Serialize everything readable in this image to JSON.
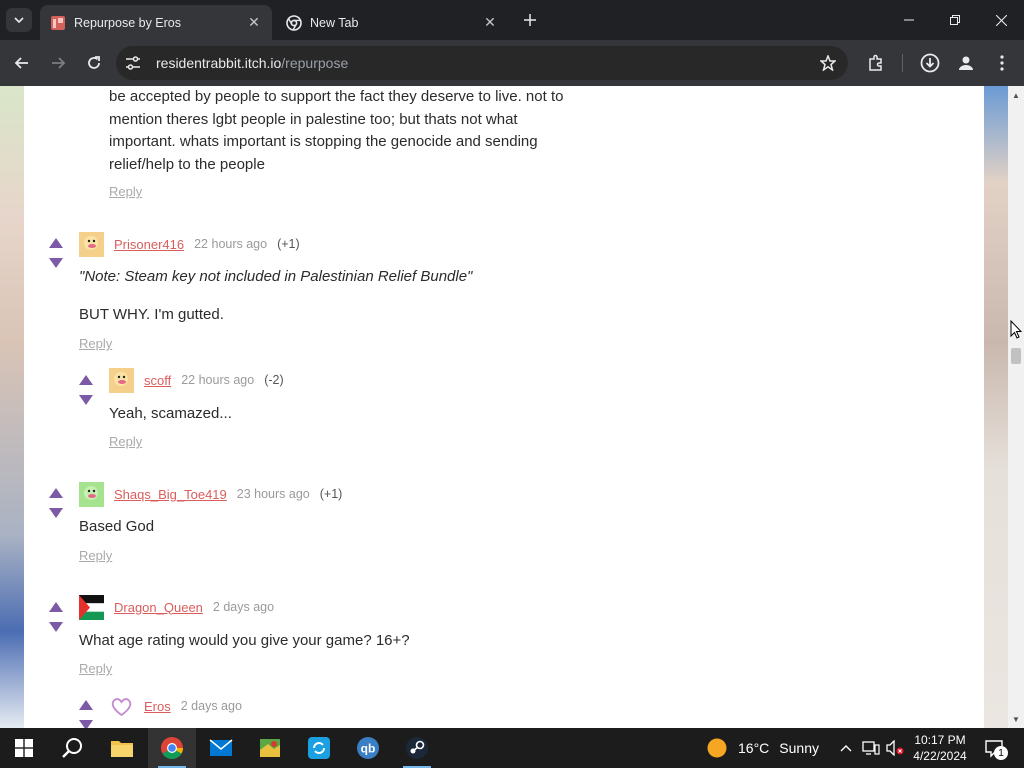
{
  "browser": {
    "tabs": [
      {
        "title": "Repurpose by Eros",
        "active": true
      },
      {
        "title": "New Tab",
        "active": false
      }
    ],
    "url_host": "residentrabbit.itch.io",
    "url_path": "/repurpose"
  },
  "page": {
    "reply_label": "Reply",
    "top_comment_tail": [
      "be accepted by people to support the fact they deserve to live. not to",
      "mention theres lgbt people in palestine too; but thats not what",
      "important. whats important is stopping the genocide and sending",
      "relief/help to the people"
    ],
    "comments": [
      {
        "username": "Prisoner416",
        "time": "22 hours ago",
        "score": "(+1)",
        "quote": "\"Note: Steam key not included in Palestinian Relief Bundle\"",
        "body": "BUT WHY. I'm gutted."
      },
      {
        "username": "scoff",
        "time": "22 hours ago",
        "score": "(-2)",
        "body": "Yeah, scamazed..."
      },
      {
        "username": "Shaqs_Big_Toe419",
        "time": "23 hours ago",
        "score": "(+1)",
        "body": "Based God"
      },
      {
        "username": "Dragon_Queen",
        "time": "2 days ago",
        "score": "",
        "body": "What age rating would you give your game? 16+?"
      },
      {
        "username": "Eros",
        "time": "2 days ago",
        "score": ""
      }
    ]
  },
  "taskbar": {
    "weather_temp": "16°C",
    "weather_desc": "Sunny",
    "time": "10:17 PM",
    "date": "4/22/2024",
    "notifications": "1"
  },
  "colors": {
    "vote_arrow": "#7c5aa6",
    "username": "#da5d5d",
    "accent_taskbar": "#76b9ed"
  }
}
